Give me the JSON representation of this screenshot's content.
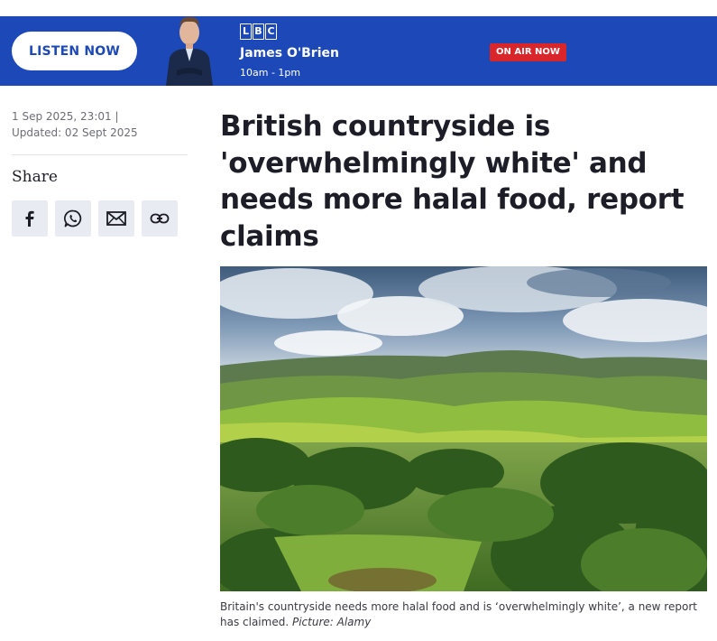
{
  "banner": {
    "listen_label": "LISTEN NOW",
    "logo_letters": [
      "L",
      "B",
      "C"
    ],
    "presenter_name": "James O'Brien",
    "show_time": "10am - 1pm",
    "onair_label": "ON AIR NOW"
  },
  "meta": {
    "published": "1 Sep 2025, 23:01 |",
    "updated": "Updated: 02 Sept 2025"
  },
  "share": {
    "label": "Share",
    "icons": [
      "facebook-icon",
      "whatsapp-icon",
      "email-icon",
      "link-icon"
    ]
  },
  "article": {
    "headline": "British countryside is 'overwhelmingly white' and needs more halal food, report claims",
    "caption_text": "Britain's countryside needs more halal food and is ‘overwhelmingly white’, a new report has claimed.",
    "caption_credit": "Picture: Alamy"
  },
  "colors": {
    "banner_blue": "#1d49b8",
    "onair_red": "#d9262b",
    "share_bg": "#e9ebf3"
  }
}
